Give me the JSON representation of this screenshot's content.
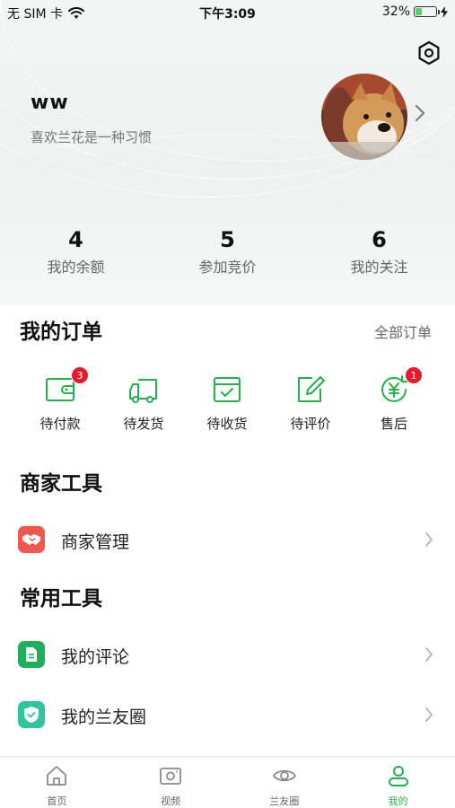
{
  "status_bar": {
    "carrier": "无 SIM 卡",
    "time": "下午3:09",
    "battery": "32%",
    "battery_level": 0.32
  },
  "profile": {
    "name": "ww",
    "bio": "喜欢兰花是一种习惯"
  },
  "stats": [
    {
      "value": "4",
      "label": "我的余额"
    },
    {
      "value": "5",
      "label": "参加竞价"
    },
    {
      "value": "6",
      "label": "我的关注"
    }
  ],
  "orders": {
    "title": "我的订单",
    "all_label": "全部订单",
    "items": [
      {
        "label": "待付款",
        "icon": "wallet-icon",
        "badge": "3"
      },
      {
        "label": "待发货",
        "icon": "truck-icon",
        "badge": ""
      },
      {
        "label": "待收货",
        "icon": "package-icon",
        "badge": ""
      },
      {
        "label": "待评价",
        "icon": "edit-icon",
        "badge": ""
      },
      {
        "label": "售后",
        "icon": "yuan-refund-icon",
        "badge": "1"
      }
    ]
  },
  "merchant_tools": {
    "title": "商家工具",
    "items": [
      {
        "label": "商家管理",
        "icon": "handshake-icon",
        "color": "#f0574e"
      }
    ]
  },
  "common_tools": {
    "title": "常用工具",
    "items": [
      {
        "label": "我的评论",
        "icon": "document-icon",
        "color": "#1fae5b"
      },
      {
        "label": "我的兰友圈",
        "icon": "shield-check-icon",
        "color": "#2fc59e"
      }
    ]
  },
  "tabbar": {
    "items": [
      {
        "label": "首页",
        "icon": "home-icon",
        "active": false
      },
      {
        "label": "视频",
        "icon": "video-icon",
        "active": false
      },
      {
        "label": "兰友圈",
        "icon": "eye-icon",
        "active": false
      },
      {
        "label": "我的",
        "icon": "user-icon",
        "active": true
      }
    ]
  },
  "colors": {
    "accent": "#23b14d",
    "badge": "#e8192c"
  }
}
